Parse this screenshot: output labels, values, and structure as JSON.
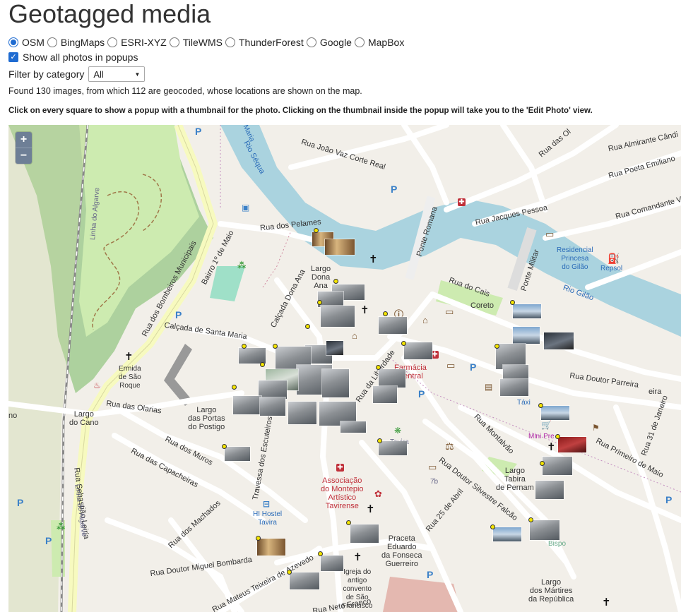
{
  "title": "Geotagged media",
  "providers": [
    {
      "label": "OSM",
      "selected": true
    },
    {
      "label": "BingMaps",
      "selected": false
    },
    {
      "label": "ESRI-XYZ",
      "selected": false
    },
    {
      "label": "TileWMS",
      "selected": false
    },
    {
      "label": "ThunderForest",
      "selected": false
    },
    {
      "label": "Google",
      "selected": false
    },
    {
      "label": "MapBox",
      "selected": false
    }
  ],
  "show_all": {
    "label": "Show all photos in popups",
    "checked": true
  },
  "filter": {
    "label": "Filter by category",
    "value": "All"
  },
  "found_text": "Found 130 images, from which 112 are geocoded, whose locations are shown on the map.",
  "hint_text": "Click on every square to show a popup with a thumbnail for the photo. Clicking on the thumbnail inside the popup will take you to the 'Edit Photo' view.",
  "map": {
    "zoom_in": "+",
    "zoom_out": "−",
    "colors": {
      "water": "#aad3df",
      "land": "#f2efe9",
      "road": "#ffffff",
      "primary": "#f7fabf",
      "park": "#cdebb0",
      "wood": "#add19e",
      "building": "#d9d0c9",
      "marker": "#f4e400"
    },
    "labels": {
      "linha_algarve": "Linha do Algarve",
      "maria": "Maria",
      "rio_sequa": "Rio Séqua",
      "rio_gilao": "Rio Gilão",
      "rua_joao_vaz": "Rua João Vaz Corte Real",
      "rua_almirante": "Rua Almirante Cândi",
      "rua_poeta": "Rua Poeta Emiliano",
      "rua_comandante": "Rua Comandante V",
      "rua_das_o": "Rua das Ol",
      "rua_jacques": "Rua Jacques Pessoa",
      "ponte_romana": "Ponte Romana",
      "ponte_militar": "Ponte Militar",
      "residencial": "Residencial\nPrincesa\ndo Gilão",
      "repsol": "Repsol",
      "rua_pelames": "Rua dos Pelames",
      "bairro": "Bairro 1º de Maio",
      "rua_bombeiros": "Rua dos Bombeiros Municipais",
      "largo_dona_ana": "Largo\nDona\nAna",
      "calcada_dona_ana": "Calçada Dona Ana",
      "calcada_santa_maria": "Calçada de Santa Maria",
      "rua_do_cais": "Rua do Cais",
      "coreto": "Coreto",
      "ermida": "Ermida\nde São\nRoque",
      "farmacia": "Farmácia\nCentral",
      "rua_doutor_parreira": "Rua Doutor Parreira",
      "eira": "eira",
      "taxi": "Táxi",
      "rua_liberdade": "Rua da Liberdade",
      "rua_olarias": "Rua das Olarias",
      "largo_cano": "Largo\ndo Cano",
      "no": "no",
      "largo_portas": "Largo\ndas Portas\ndo Postigo",
      "travessa": "Travessa dos Escuteiros",
      "tavira": "Tavira",
      "rua_montalvao": "Rua Montalvão",
      "mini_pre": "Mini Pre",
      "rua_primeiro_maio": "Rua Primeiro de Maio",
      "rua_31_janeiro": "Rua 31 de Janeiro",
      "rua_capacheiras": "Rua das Capacheiras",
      "rua_muros": "Rua dos Muros",
      "rua_sebastiao": "Rua Sebastião Leiria",
      "linha_algarve2": "Linha do Algarve",
      "associacao": "Associação\ndo Montepio\nArtístico\nTavirense",
      "largo_tabira": "Largo\nTabira\nde Pernam",
      "rua_silvestre": "Rua Doutor Silvestre Falcão",
      "rua_25_abril": "Rua 25 de Abril",
      "seven_b": "7b",
      "rua_machados": "Rua dos Machados",
      "hi_hostel": "HI Hostel\nTavira",
      "praceta": "Praceta\nEduardo\nda Fonseca\nGuerreiro",
      "bispo": "Bispo",
      "largo_martires": "Largo\ndos Mártires\nda República",
      "rua_miguel_bombarda": "Rua Doutor Miguel Bombarda",
      "rua_mateus": "Rua Mateus Teixeira de Azevedo",
      "igreja": "Igreja do\nantigo\nconvento\nde São\nFrancisco",
      "rua_n_fr": "Rua Neto Franco"
    }
  }
}
